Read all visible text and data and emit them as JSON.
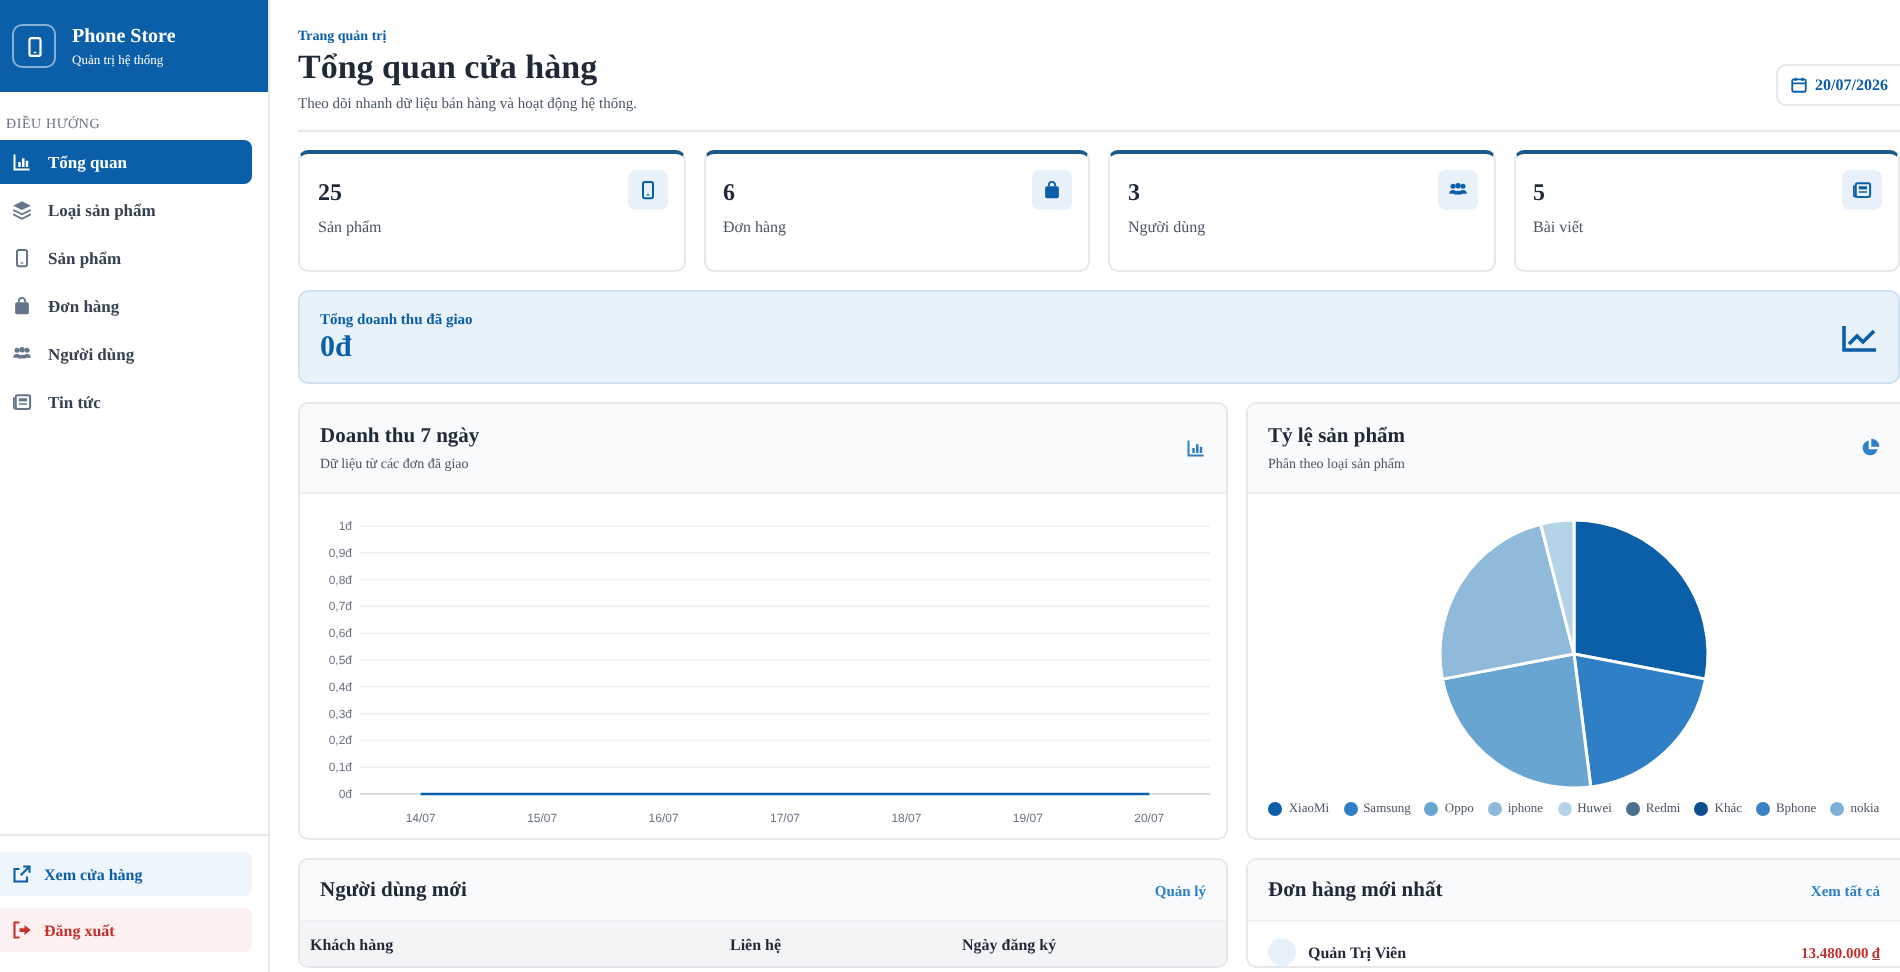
{
  "sidebar": {
    "brand": {
      "name": "Phone Store",
      "subtitle": "Quản trị hệ thống"
    },
    "nav_heading": "ĐIỀU HƯỚNG",
    "items": [
      {
        "label": "Tổng quan",
        "kind": "chart",
        "selected": true
      },
      {
        "label": "Loại sản phẩm",
        "kind": "layers",
        "selected": false
      },
      {
        "label": "Sản phẩm",
        "kind": "phone",
        "selected": false
      },
      {
        "label": "Đơn hàng",
        "kind": "bag",
        "selected": false
      },
      {
        "label": "Người dùng",
        "kind": "users",
        "selected": false
      },
      {
        "label": "Tin tức",
        "kind": "news",
        "selected": false
      }
    ],
    "footer": [
      {
        "label": "Xem cửa hàng",
        "kind": "link"
      },
      {
        "label": "Đăng xuất",
        "kind": "logout"
      }
    ]
  },
  "header": {
    "breadcrumb": "Trang quản trị",
    "title": "Tổng quan cửa hàng",
    "subtitle": "Theo dõi nhanh dữ liệu bán hàng và hoạt động hệ thống.",
    "date": "20/07/2026"
  },
  "stats": [
    {
      "value": "25",
      "label": "Sản phẩm",
      "kind": "phone"
    },
    {
      "value": "6",
      "label": "Đơn hàng",
      "kind": "bag"
    },
    {
      "value": "3",
      "label": "Người dùng",
      "kind": "users"
    },
    {
      "value": "5",
      "label": "Bài viết",
      "kind": "news"
    }
  ],
  "revenue": {
    "label": "Tổng doanh thu đã giao",
    "value": "0đ"
  },
  "revenue_chart": {
    "title": "Doanh thu 7 ngày",
    "subtitle": "Dữ liệu từ các đơn đã giao",
    "chart_data": {
      "type": "line",
      "categories": [
        "14/07",
        "15/07",
        "16/07",
        "17/07",
        "18/07",
        "19/07",
        "20/07"
      ],
      "series": [
        {
          "color": "#0b5ea8",
          "values": [
            0,
            0,
            0,
            0,
            0,
            0,
            0
          ]
        }
      ],
      "grid": true,
      "ylim": [
        0,
        1
      ],
      "yticks": [
        {
          "value": 0,
          "label": "0đ"
        },
        {
          "value": 0.1,
          "label": "0,1đ"
        },
        {
          "value": 0.2,
          "label": "0,2đ"
        },
        {
          "value": 0.3,
          "label": "0,3đ"
        },
        {
          "value": 0.4,
          "label": "0,4đ"
        },
        {
          "value": 0.5,
          "label": "0,5đ"
        },
        {
          "value": 0.6,
          "label": "0,6đ"
        },
        {
          "value": 0.7,
          "label": "0,7đ"
        },
        {
          "value": 0.8,
          "label": "0,8đ"
        },
        {
          "value": 0.9,
          "label": "0,9đ"
        },
        {
          "value": 1,
          "label": "1đ"
        }
      ]
    }
  },
  "product_chart": {
    "title": "Tỷ lệ sản phẩm",
    "subtitle": "Phân theo loại sản phẩm",
    "chart_data": {
      "type": "pie",
      "categories": [
        "XiaoMi",
        "Samsung",
        "Oppo",
        "iphone",
        "Huwei",
        "Redmi",
        "Khác",
        "Bphone",
        "nokia"
      ],
      "values": [
        28,
        20,
        24,
        24,
        4,
        0,
        0,
        0,
        0
      ],
      "legend": true
    }
  },
  "new_users": {
    "title": "Người dùng mới",
    "action": "Quản lý",
    "columns": [
      "Khách hàng",
      "Liên hệ",
      "Ngày đăng ký"
    ]
  },
  "latest_orders": {
    "title": "Đơn hàng mới nhất",
    "action": "Xem tất cả",
    "rows": [
      {
        "name": "Quản Trị Viên",
        "amount": "13.480.000 ₫"
      }
    ]
  }
}
